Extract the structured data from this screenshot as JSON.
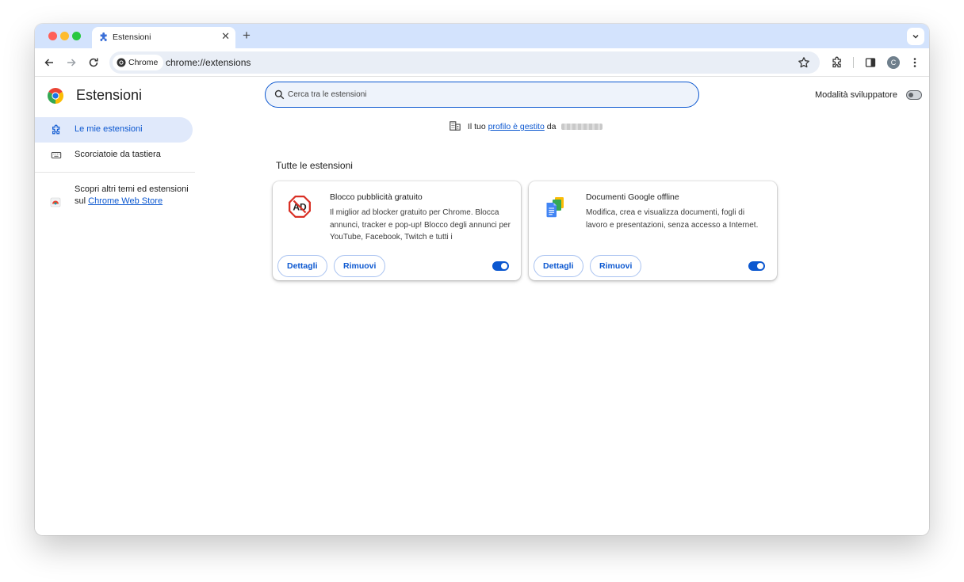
{
  "browser": {
    "tab_title": "Estensioni",
    "chip_label": "Chrome",
    "url": "chrome://extensions",
    "avatar_letter": "C"
  },
  "header": {
    "title": "Estensioni",
    "search_placeholder": "Cerca tra le estensioni",
    "dev_mode_label": "Modalità sviluppatore",
    "dev_mode_on": false
  },
  "sidebar": {
    "items": [
      {
        "label": "Le mie estensioni",
        "active": true
      },
      {
        "label": "Scorciatoie da tastiera",
        "active": false
      }
    ],
    "store_text": "Scopri altri temi ed estensioni sul",
    "store_link": "Chrome Web Store"
  },
  "notice": {
    "prefix": "Il tuo",
    "link": "profilo è gestito",
    "suffix": "da"
  },
  "section_title": "Tutte le estensioni",
  "extensions": [
    {
      "name": "Blocco pubblicità gratuito",
      "description": "Il miglior ad blocker gratuito per Chrome. Blocca annunci, tracker e pop-up! Blocco degli annunci per YouTube, Facebook, Twitch e tutti i",
      "details_label": "Dettagli",
      "remove_label": "Rimuovi",
      "enabled": true,
      "icon": "ad-block-icon"
    },
    {
      "name": "Documenti Google offline",
      "description": "Modifica, crea e visualizza documenti, fogli di lavoro e presentazioni, senza accesso a Internet.",
      "details_label": "Dettagli",
      "remove_label": "Rimuovi",
      "enabled": true,
      "icon": "google-docs-icon"
    }
  ],
  "colors": {
    "accent": "#0b57d0",
    "tabstrip": "#d3e3fd",
    "active_nav": "#e0e9fb"
  }
}
